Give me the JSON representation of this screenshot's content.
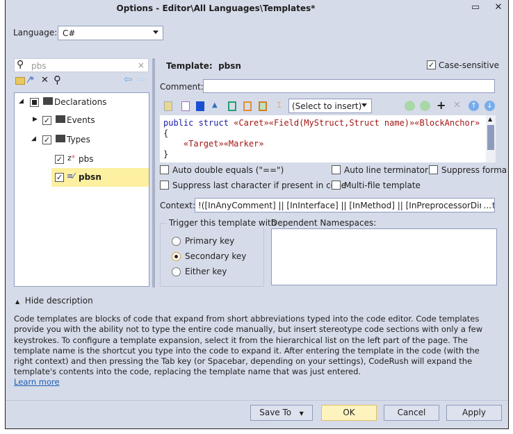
{
  "window": {
    "title": "Options - Editor\\All Languages\\Templates*",
    "maximize_icon": "maximize-icon",
    "close_icon": "close-icon"
  },
  "language": {
    "label": "Language:",
    "value": "C#"
  },
  "search": {
    "value": "pbs",
    "clear": "×"
  },
  "tree": [
    {
      "label": "Declarations",
      "checked": "partial",
      "expanded": true
    },
    {
      "label": "Events",
      "checked": true,
      "expanded": false
    },
    {
      "label": "Types",
      "checked": true,
      "expanded": true
    },
    {
      "label": "pbs",
      "checked": true
    },
    {
      "label": "pbsn",
      "checked": true,
      "selected": true
    }
  ],
  "template": {
    "label": "Template:",
    "name": "pbsn",
    "case_sensitive": "Case-sensitive"
  },
  "comment": {
    "label": "Comment:",
    "value": ""
  },
  "insert_select": "(Select to insert)",
  "code": {
    "line1_kw": "public struct ",
    "line1_ph": "«Caret»«Field(MyStruct,Struct name)»«BlockAnchor»",
    "line2": "{",
    "line3_ph": "«Target»«Marker»",
    "line4": "}"
  },
  "options": {
    "auto_double_equals": "Auto double equals (\"==\")",
    "auto_line_terminator": "Auto line terminator",
    "suppress_format": "Suppress forma",
    "suppress_last_char": "Suppress last character if present in code",
    "multi_file": "Multi-file template"
  },
  "context": {
    "label": "Context:",
    "value": "!([InAnyComment] || [InInterface] || [InMethod] || [InPreprocessorDirective] || [",
    "more": "..."
  },
  "trigger": {
    "title": "Trigger this template with",
    "options": [
      "Primary key",
      "Secondary key",
      "Either key"
    ],
    "selected": "Secondary key"
  },
  "namespaces": {
    "label": "Dependent Namespaces:"
  },
  "description": {
    "toggle": "Hide description",
    "text": "Code templates are blocks of code that expand from short abbreviations typed into the code editor. Code templates provide you with the ability not to type the entire code manually, but insert stereotype code sections with only a few keystrokes. To configure a template expansion, select it from the hierarchical list on the left part of the page. The template name is the shortcut you type into the code to expand it. After entering the template in the code (with the right context) and then pressing the Tab key (or Spacebar, depending on your settings), CodeRush will expand the template's contents into the code, replacing the template name that was just entered.",
    "link": "Learn more"
  },
  "buttons": {
    "save_to": "Save To",
    "ok": "OK",
    "cancel": "Cancel",
    "apply": "Apply"
  },
  "colors": {
    "background": "#d6dbe9",
    "selection": "#fdf0a0",
    "ok_button": "#fdf3bf",
    "link": "#1a5fb4"
  }
}
